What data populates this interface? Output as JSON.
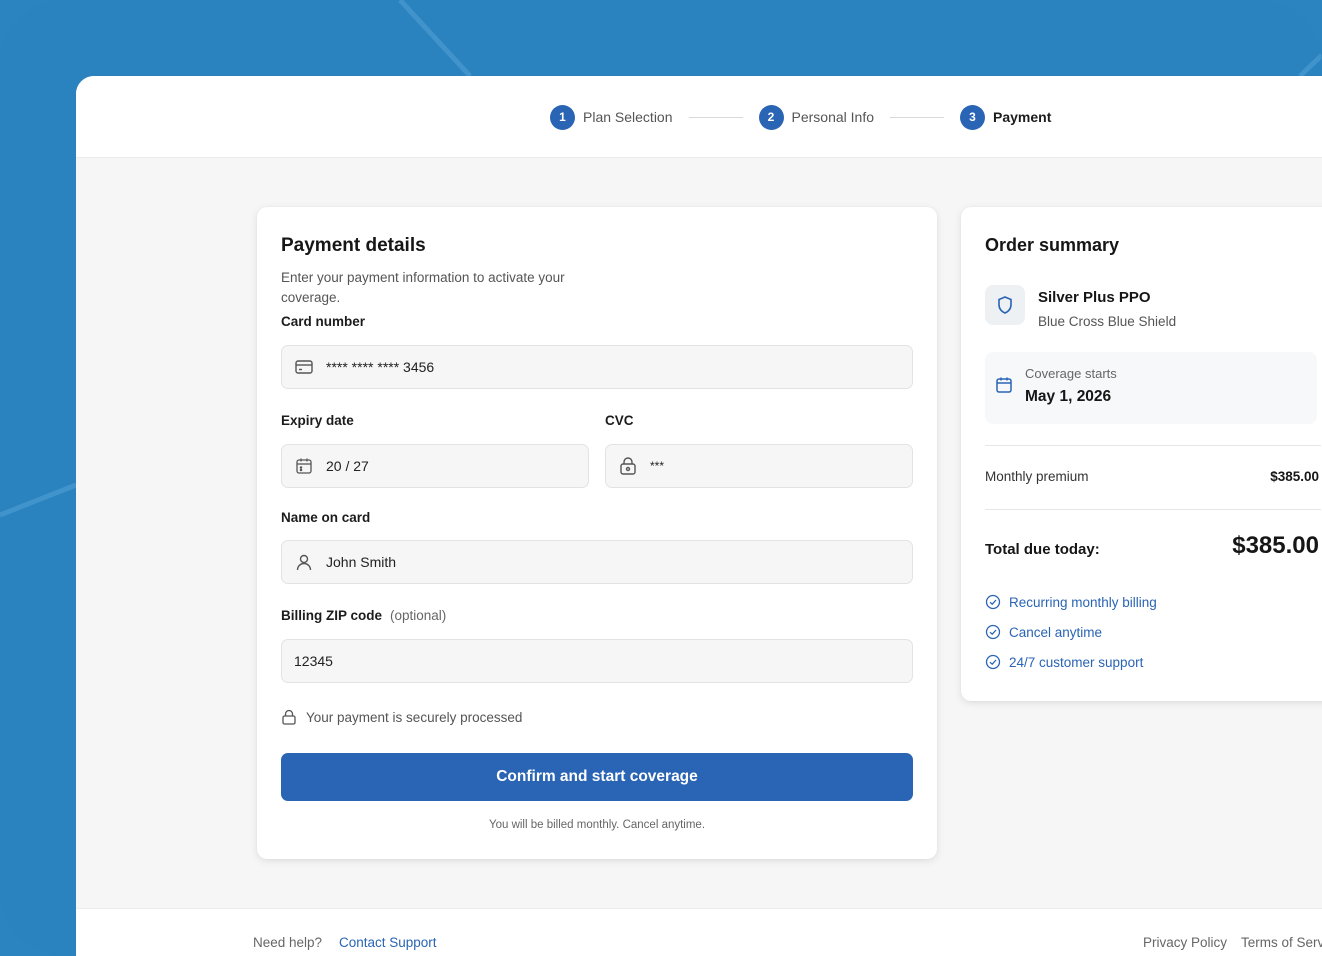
{
  "stepper": {
    "steps": [
      {
        "number": "1",
        "label": "Plan Selection"
      },
      {
        "number": "2",
        "label": "Personal Info"
      },
      {
        "number": "3",
        "label": "Payment"
      }
    ]
  },
  "payment": {
    "title": "Payment details",
    "subtitle": "Enter your payment information to activate your coverage.",
    "card_number_label": "Card number",
    "card_number_value": "**** **** **** 3456",
    "expiry_label": "Expiry date",
    "expiry_value": "20 / 27",
    "cvc_label": "CVC",
    "cvc_value": "***",
    "name_label": "Name on card",
    "name_value": "John Smith",
    "zip_label": "Billing ZIP code",
    "zip_optional": "(optional)",
    "zip_value": "12345",
    "secure_text": "Your payment is securely processed",
    "submit_label": "Confirm and start coverage",
    "billing_note": "You will be billed monthly. Cancel anytime."
  },
  "summary": {
    "title": "Order summary",
    "plan_name": "Silver Plus PPO",
    "plan_provider": "Blue Cross Blue Shield",
    "coverage_label": "Coverage starts",
    "coverage_date": "May 1, 2026",
    "premium_label": "Monthly premium",
    "premium_value": "$385.00",
    "total_label": "Total due today:",
    "total_value": "$385.00",
    "features": [
      "Recurring monthly billing",
      "Cancel anytime",
      "24/7 customer support"
    ]
  },
  "footer": {
    "help_text": "Need help?",
    "contact_link": "Contact Support",
    "privacy_link": "Privacy Policy",
    "terms_link": "Terms of Service"
  },
  "colors": {
    "accent": "#2a64b4",
    "background": "#2a82bf"
  },
  "icons": {
    "card": "credit-card-icon",
    "expiry": "calendar-icon",
    "cvc": "lock-icon",
    "name": "user-icon",
    "secure": "lock-icon",
    "plan": "shield-icon",
    "coverage": "calendar-icon",
    "feature": "check-circle-icon"
  }
}
